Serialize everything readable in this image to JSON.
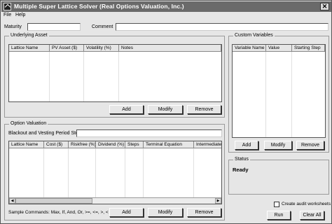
{
  "window": {
    "title": "Multiple Super Lattice Solver (Real Options Valuation, Inc.)",
    "close_glyph": "✕"
  },
  "app_icon": "lattice-app-icon",
  "menu": [
    "File",
    "Help"
  ],
  "header": {
    "maturity_label": "Maturity",
    "maturity_value": "",
    "comment_label": "Comment",
    "comment_value": ""
  },
  "underlying": {
    "title": "Underlying Asset",
    "columns": [
      "Lattice Name",
      "PV Asset ($)",
      "Volatility (%)",
      "Notes"
    ],
    "buttons": {
      "add": "Add",
      "modify": "Modify",
      "remove": "Remove"
    }
  },
  "custom_vars": {
    "title": "Custom Variables",
    "columns": [
      "Variable Name",
      "Value",
      "Starting Step"
    ],
    "buttons": {
      "add": "Add",
      "modify": "Modify",
      "remove": "Remove"
    }
  },
  "option_valuation": {
    "title": "Option Valuation",
    "blackout_label": "Blackout and Vesting Period Steps",
    "blackout_value": "",
    "columns": [
      "Lattice Name",
      "Cost ($)",
      "Riskfree (%)",
      "Dividend (%)",
      "Steps",
      "Terminal Equation",
      "Intermediate"
    ],
    "sample_commands": "Sample Commands: Max, If, And, Or, >=, <=, >, <",
    "buttons": {
      "add": "Add",
      "modify": "Modify",
      "remove": "Remove"
    }
  },
  "status": {
    "title": "Status",
    "text": "Ready"
  },
  "audit_checkbox": {
    "label": "Create audit worksheets",
    "checked": false
  },
  "actions": {
    "run": "Run",
    "clear_all": "Clear All"
  },
  "scroll_glyphs": {
    "left": "◀",
    "right": "▶"
  }
}
